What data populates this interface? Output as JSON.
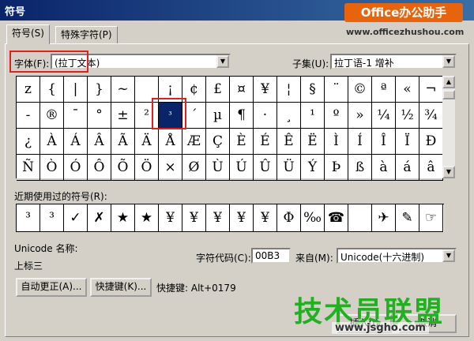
{
  "window": {
    "title": "符号"
  },
  "watermark": {
    "badge": "Office办公助手",
    "url": "www.officezhushou.com",
    "logo": "技术员联盟",
    "site": "www.jsgho.com"
  },
  "tabs": [
    {
      "label": "符号(S)",
      "active": true
    },
    {
      "label": "特殊字符(P)",
      "active": false
    }
  ],
  "font": {
    "label": "字体(F):",
    "value": "(拉丁文本)"
  },
  "subset": {
    "label": "子集(U):",
    "value": "拉丁语-1 增补"
  },
  "symbols": [
    "z",
    "{",
    "|",
    "}",
    "~",
    " ",
    "¡",
    "¢",
    "£",
    "¤",
    "¥",
    "¦",
    "§",
    "¨",
    "©",
    "ª",
    "«",
    "¬",
    "-",
    "®",
    "¯",
    "°",
    "±",
    "²",
    "³",
    "´",
    "µ",
    "¶",
    "·",
    "¸",
    "¹",
    "º",
    "»",
    "¼",
    "½",
    "¾",
    "¿",
    "À",
    "Á",
    "Â",
    "Ã",
    "Ä",
    "Å",
    "Æ",
    "Ç",
    "È",
    "É",
    "Ê",
    "Ë",
    "Ì",
    "Í",
    "Î",
    "Ï",
    "Ð",
    "Ñ",
    "Ò",
    "Ó",
    "Ô",
    "Õ",
    "Ö",
    "×",
    "Ø",
    "Ù",
    "Ú",
    "Û",
    "Ü",
    "Ý",
    "Þ",
    "ß",
    "à",
    "á",
    "â"
  ],
  "selected_symbol": "³",
  "recent": {
    "label": "近期使用过的符号(R):",
    "items": [
      "³",
      "³",
      "✓",
      "✗",
      "★",
      "★",
      "¥",
      "¥",
      "¥",
      "¥",
      "¥",
      "Φ",
      "‰",
      "☎",
      " ",
      "✈",
      "✎",
      "☞"
    ]
  },
  "unicode": {
    "label": "Unicode 名称:",
    "value": "上标三"
  },
  "char_code": {
    "label": "字符代码(C):",
    "value": "00B3"
  },
  "from": {
    "label": "来自(M):",
    "value": "Unicode(十六进制)"
  },
  "buttons": {
    "autocorrect": "自动更正(A)...",
    "shortcut": "快捷键(K)...",
    "shortcut_text": "快捷键: Alt+0179",
    "insert": "插入(I)",
    "cancel": "取消"
  }
}
